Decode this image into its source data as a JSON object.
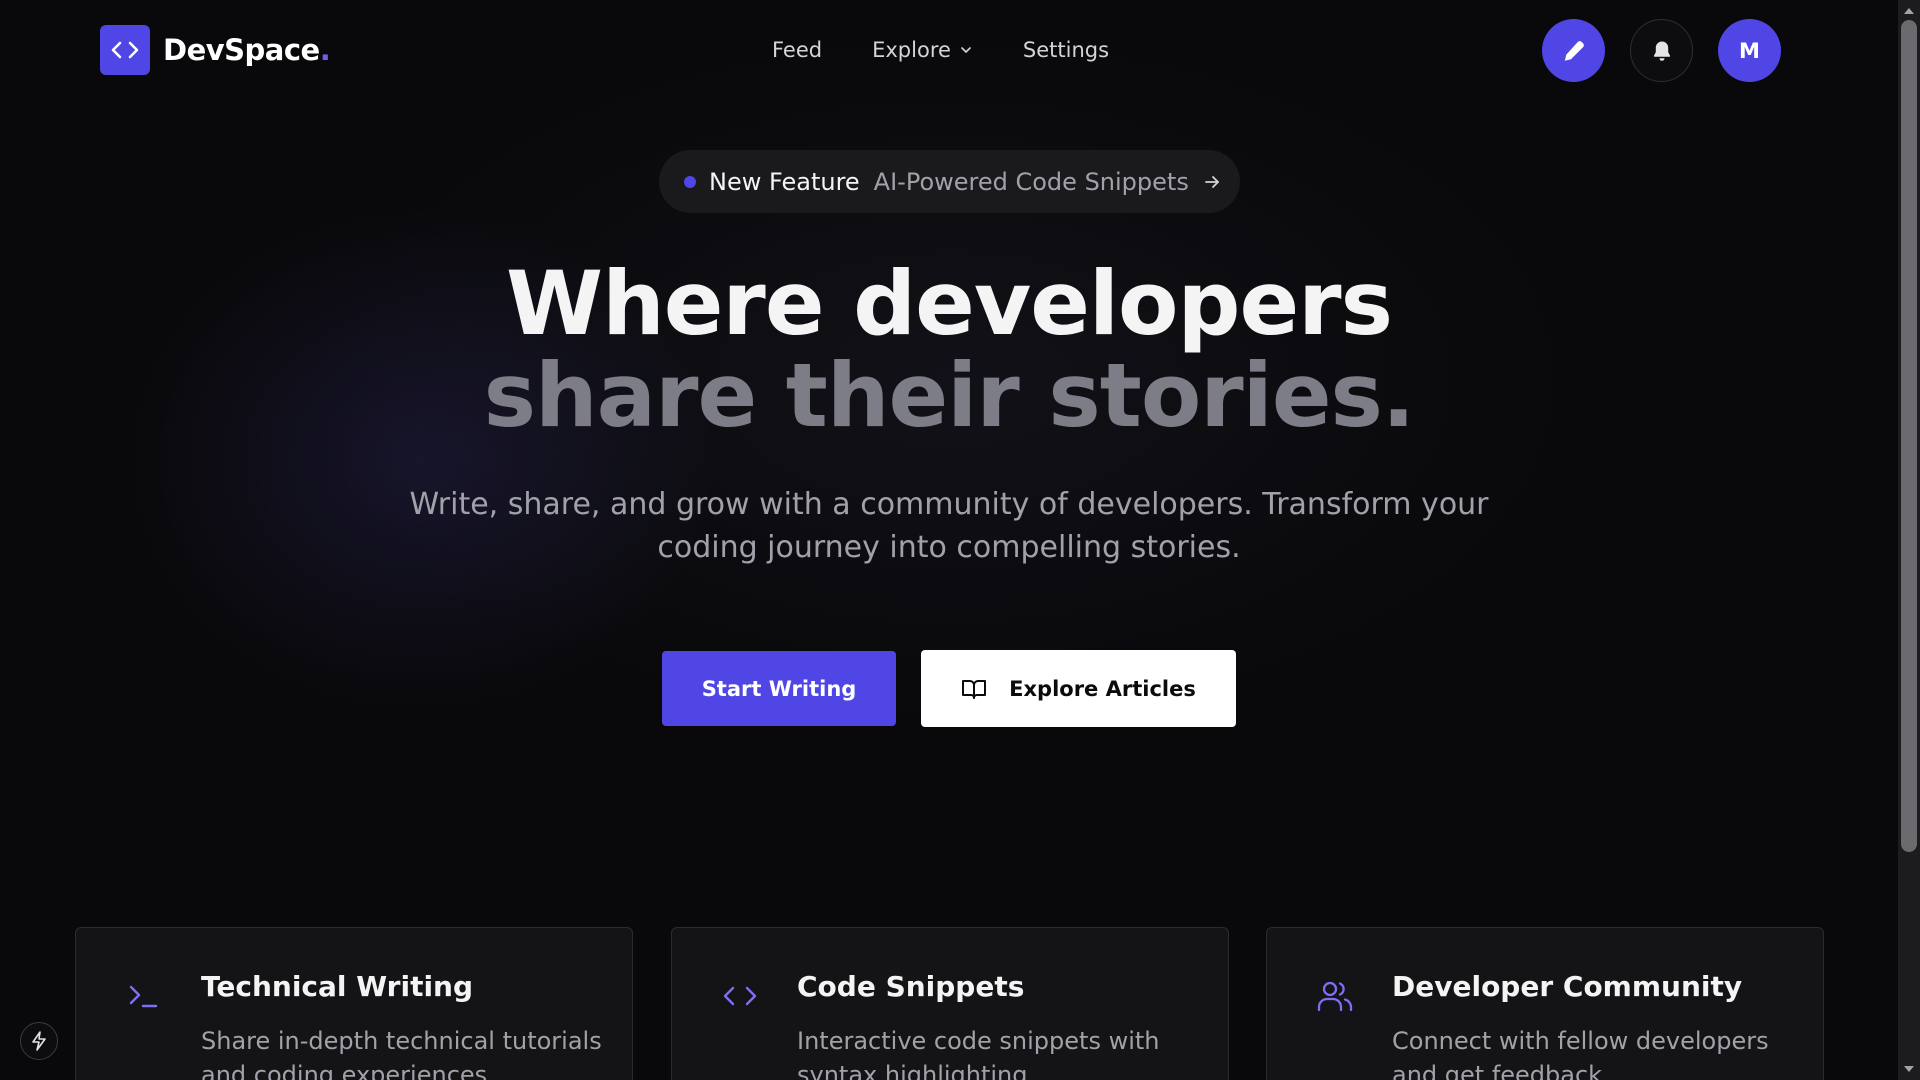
{
  "brand": {
    "name": "DevSpace",
    "dot": ".",
    "logo_icon": "code-brackets-icon",
    "accent_color": "#5046e5"
  },
  "nav": {
    "links": [
      {
        "label": "Feed"
      },
      {
        "label": "Explore",
        "icon": "chevron-down-icon"
      },
      {
        "label": "Settings"
      }
    ],
    "actions": {
      "write_icon": "pen-icon",
      "notifications_icon": "bell-icon",
      "avatar_initial": "M"
    }
  },
  "hero": {
    "badge": {
      "label": "New Feature",
      "text": "AI-Powered Code Snippets",
      "icon": "arrow-right-icon"
    },
    "title_line1": "Where developers",
    "title_line2": "share their stories.",
    "subtitle": "Write, share, and grow with a community of developers. Transform your coding journey into compelling stories.",
    "primary_cta": "Start Writing",
    "secondary_cta": "Explore Articles",
    "secondary_cta_icon": "book-open-icon"
  },
  "features": [
    {
      "icon": "terminal-icon",
      "title": "Technical Writing",
      "description": "Share in-depth technical tutorials and coding experiences"
    },
    {
      "icon": "code-icon",
      "title": "Code Snippets",
      "description": "Interactive code snippets with syntax highlighting"
    },
    {
      "icon": "users-icon",
      "title": "Developer Community",
      "description": "Connect with fellow developers and get feedback"
    }
  ],
  "floating": {
    "icon": "lightning-bolt-icon"
  }
}
